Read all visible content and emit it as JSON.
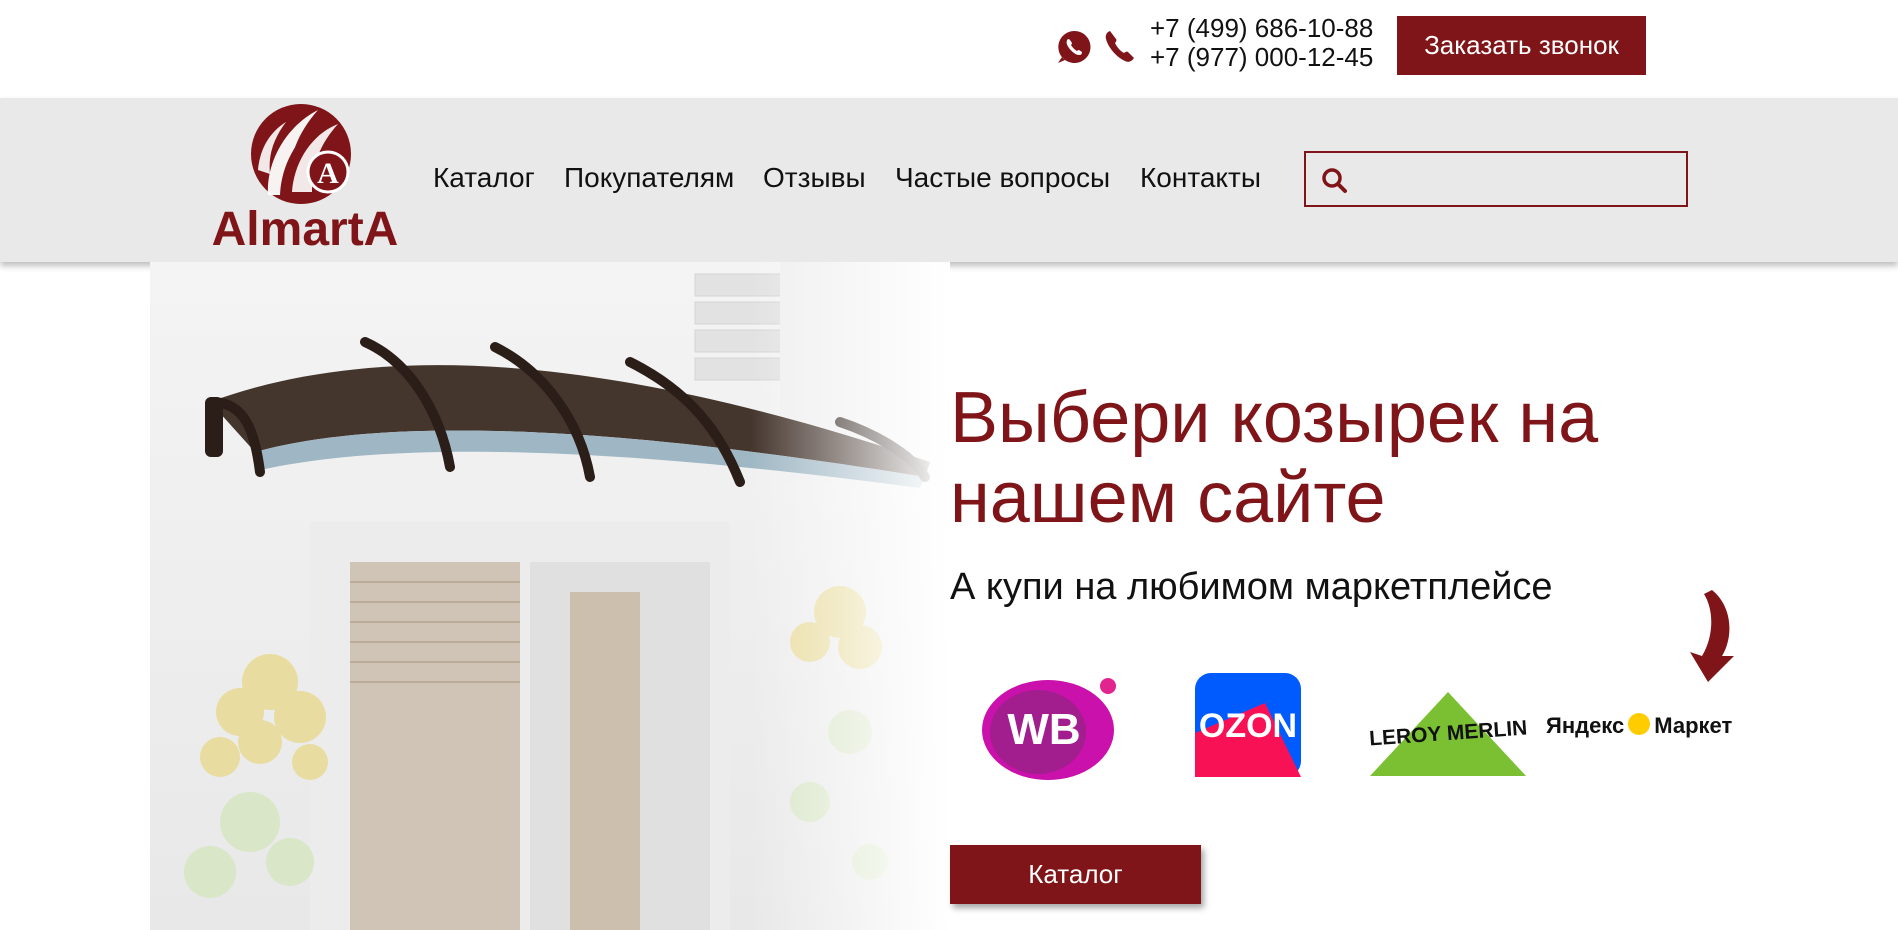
{
  "header": {
    "phones": [
      "+7 (499) 686-10-88",
      "+7 (977) 000-12-45"
    ],
    "callback_label": "Заказать звонок",
    "icons": [
      "whatsapp-icon",
      "phone-icon"
    ]
  },
  "logo": {
    "text": "AlmartA",
    "emblem_letter": "A"
  },
  "nav": {
    "items": [
      {
        "label": "Каталог"
      },
      {
        "label": "Покупателям"
      },
      {
        "label": "Отзывы"
      },
      {
        "label": "Частые вопросы"
      },
      {
        "label": "Контакты"
      }
    ],
    "search": {
      "value": "",
      "icon": "search-icon"
    }
  },
  "hero": {
    "title": "Выбери козырек на нашем сайте",
    "subtitle": "А купи на любимом маркетплейсе",
    "marketplaces": [
      {
        "name": "WB",
        "icon": "wildberries-logo"
      },
      {
        "name": "OZON",
        "icon": "ozon-logo"
      },
      {
        "name": "LEROY MERLIN",
        "icon": "leroy-merlin-logo"
      },
      {
        "name_left": "Яндекс",
        "name_right": "Маркет",
        "icon": "yandex-market-logo"
      }
    ],
    "catalog_button": "Каталог"
  },
  "colors": {
    "brand": "#7f1518",
    "nav_background": "#e9e9e9",
    "yandex_yellow": "#ffcc00",
    "wb_purple": "#a21d8e",
    "ozon_blue": "#005bff",
    "leroy_green": "#7bc033"
  }
}
